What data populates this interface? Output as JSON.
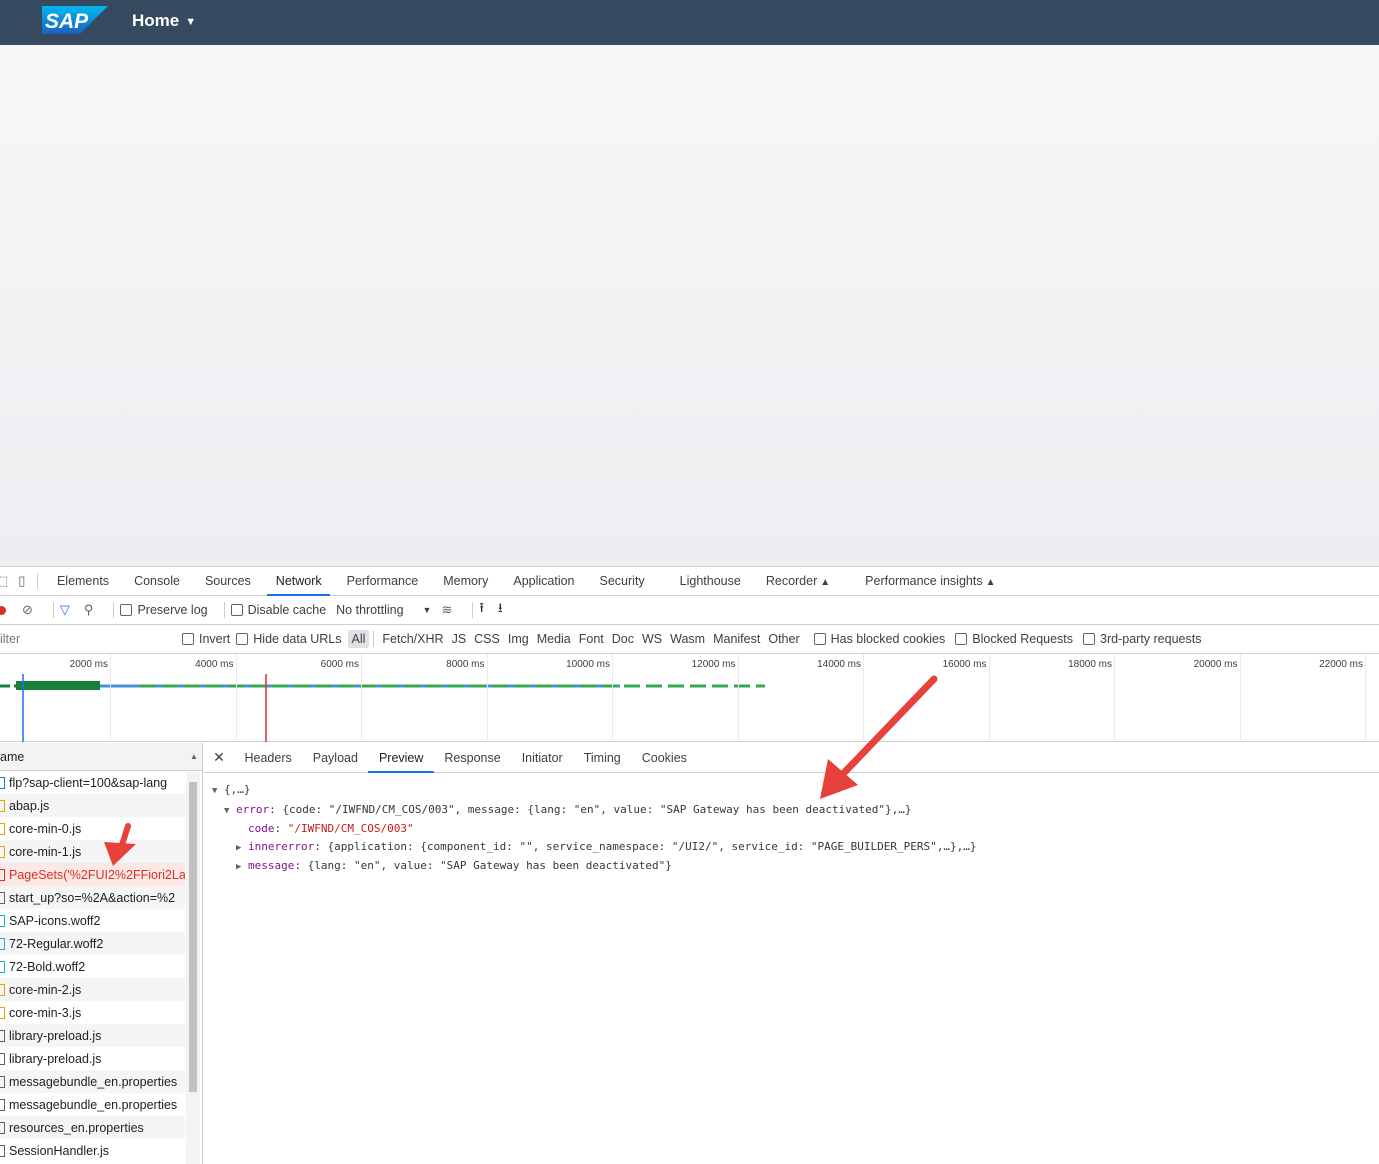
{
  "shell": {
    "logo_text": "SAP",
    "home_label": "Home",
    "bg_color": "#354a5f"
  },
  "devtools": {
    "tabs": [
      "Elements",
      "Console",
      "Sources",
      "Network",
      "Performance",
      "Memory",
      "Application",
      "Security",
      "Lighthouse",
      "Recorder",
      "Performance insights"
    ],
    "active_tab": "Network",
    "toolbar": {
      "preserve_log": "Preserve log",
      "disable_cache": "Disable cache",
      "throttling": "No throttling"
    },
    "filter": {
      "placeholder": "ilter",
      "invert": "Invert",
      "hide_data_urls": "Hide data URLs",
      "types": [
        "All",
        "Fetch/XHR",
        "JS",
        "CSS",
        "Img",
        "Media",
        "Font",
        "Doc",
        "WS",
        "Wasm",
        "Manifest",
        "Other"
      ],
      "active_type": "All",
      "has_blocked_cookies": "Has blocked cookies",
      "blocked_requests": "Blocked Requests",
      "third_party": "3rd-party requests"
    },
    "overview": {
      "ticks": [
        "2000 ms",
        "4000 ms",
        "6000 ms",
        "8000 ms",
        "10000 ms",
        "12000 ms",
        "14000 ms",
        "16000 ms",
        "18000 ms",
        "20000 ms",
        "22000 ms"
      ]
    },
    "requests": {
      "header": "ame",
      "rows": [
        {
          "name": "flp?sap-client=100&sap-lang",
          "type": "doc"
        },
        {
          "name": "abap.js",
          "type": "js"
        },
        {
          "name": "core-min-0.js",
          "type": "js"
        },
        {
          "name": "core-min-1.js",
          "type": "js"
        },
        {
          "name": "PageSets('%2FUI2%2FFiori2La",
          "type": "err"
        },
        {
          "name": "start_up?so=%2A&action=%2",
          "type": "other"
        },
        {
          "name": "SAP-icons.woff2",
          "type": "font"
        },
        {
          "name": "72-Regular.woff2",
          "type": "font"
        },
        {
          "name": "72-Bold.woff2",
          "type": "font"
        },
        {
          "name": "core-min-2.js",
          "type": "js"
        },
        {
          "name": "core-min-3.js",
          "type": "js"
        },
        {
          "name": "library-preload.js",
          "type": "other"
        },
        {
          "name": "library-preload.js",
          "type": "other"
        },
        {
          "name": "messagebundle_en.properties",
          "type": "other"
        },
        {
          "name": "messagebundle_en.properties",
          "type": "other"
        },
        {
          "name": "resources_en.properties",
          "type": "other"
        },
        {
          "name": "SessionHandler.js",
          "type": "other"
        }
      ],
      "selected_index": 4
    },
    "detail": {
      "tabs": [
        "Headers",
        "Payload",
        "Preview",
        "Response",
        "Initiator",
        "Timing",
        "Cookies"
      ],
      "active_tab": "Preview",
      "preview": {
        "root": "{,…}",
        "error_key": "error",
        "error_summary": "{code: \"/IWFND/CM_COS/003\", message: {lang: \"en\", value: \"SAP Gateway has been deactivated\"},…}",
        "code_key": "code",
        "code_value": "\"/IWFND/CM_COS/003\"",
        "innererror_key": "innererror",
        "innererror_summary": "{application: {component_id: \"\", service_namespace: \"/UI2/\", service_id: \"PAGE_BUILDER_PERS\",…},…}",
        "message_key": "message",
        "message_summary": "{lang: \"en\", value: \"SAP Gateway has been deactivated\"}"
      }
    }
  }
}
